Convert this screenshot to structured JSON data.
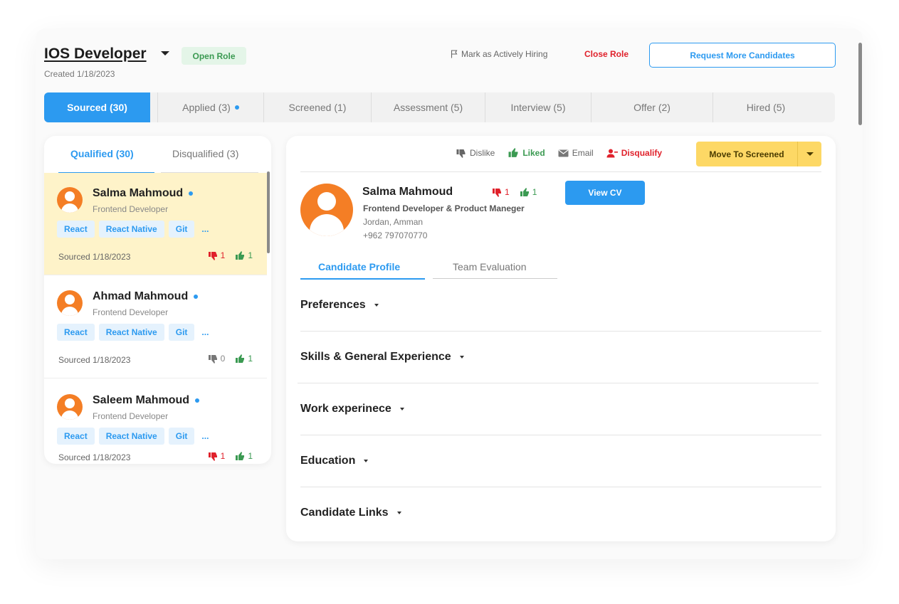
{
  "header": {
    "role_title": "IOS Developer",
    "role_status": "Open Role",
    "created": "Created 1/18/2023",
    "mark_hiring": "Mark as Actively Hiring",
    "close_role": "Close Role",
    "request_more": "Request More Candidates"
  },
  "stages": [
    {
      "label": "Sourced (30)"
    },
    {
      "label": "Applied (3)"
    },
    {
      "label": "Screened (1)"
    },
    {
      "label": "Assessment (5)"
    },
    {
      "label": "Interview (5)"
    },
    {
      "label": "Offer (2)"
    },
    {
      "label": "Hired (5)"
    }
  ],
  "list": {
    "tab_qualified": "Qualified (30)",
    "tab_disqualified": "Disqualified (3)",
    "candidates": [
      {
        "name": "Salma Mahmoud",
        "role": "Frontend Developer",
        "tags": [
          "React",
          "React Native",
          "Git",
          "..."
        ],
        "sourced": "Sourced 1/18/2023",
        "dislikes": "1",
        "likes": "1"
      },
      {
        "name": "Ahmad Mahmoud",
        "role": "Frontend Developer",
        "tags": [
          "React",
          "React Native",
          "Git",
          "..."
        ],
        "sourced": "Sourced 1/18/2023",
        "dislikes": "0",
        "likes": "1"
      },
      {
        "name": "Saleem Mahmoud",
        "role": "Frontend Developer",
        "tags": [
          "React",
          "React Native",
          "Git",
          "..."
        ],
        "sourced": "Sourced 1/18/2023",
        "dislikes": "1",
        "likes": "1"
      }
    ]
  },
  "detail": {
    "actions": {
      "dislike": "Dislike",
      "liked": "Liked",
      "email": "Email",
      "disqualify": "Disqualify",
      "move": "Move To Screened"
    },
    "name": "Salma Mahmoud",
    "dislikes": "1",
    "likes": "1",
    "view_cv": "View CV",
    "role": "Frontend Developer & Product Maneger",
    "location": "Jordan, Amman",
    "phone": "+962 797070770",
    "tab_profile": "Candidate Profile",
    "tab_evaluation": "Team Evaluation",
    "sections": [
      "Preferences",
      "Skills & General Experience",
      "Work experinece",
      "Education",
      "Candidate Links"
    ]
  },
  "colors": {
    "primary": "#2c9af0",
    "open_badge_bg": "#e4f5e8",
    "open_badge_text": "#3b9a52",
    "danger": "#e0212b",
    "success": "#3b9a52",
    "selected_card": "#fef3c9",
    "move_button": "#fdd865",
    "avatar": "#f47e25"
  }
}
